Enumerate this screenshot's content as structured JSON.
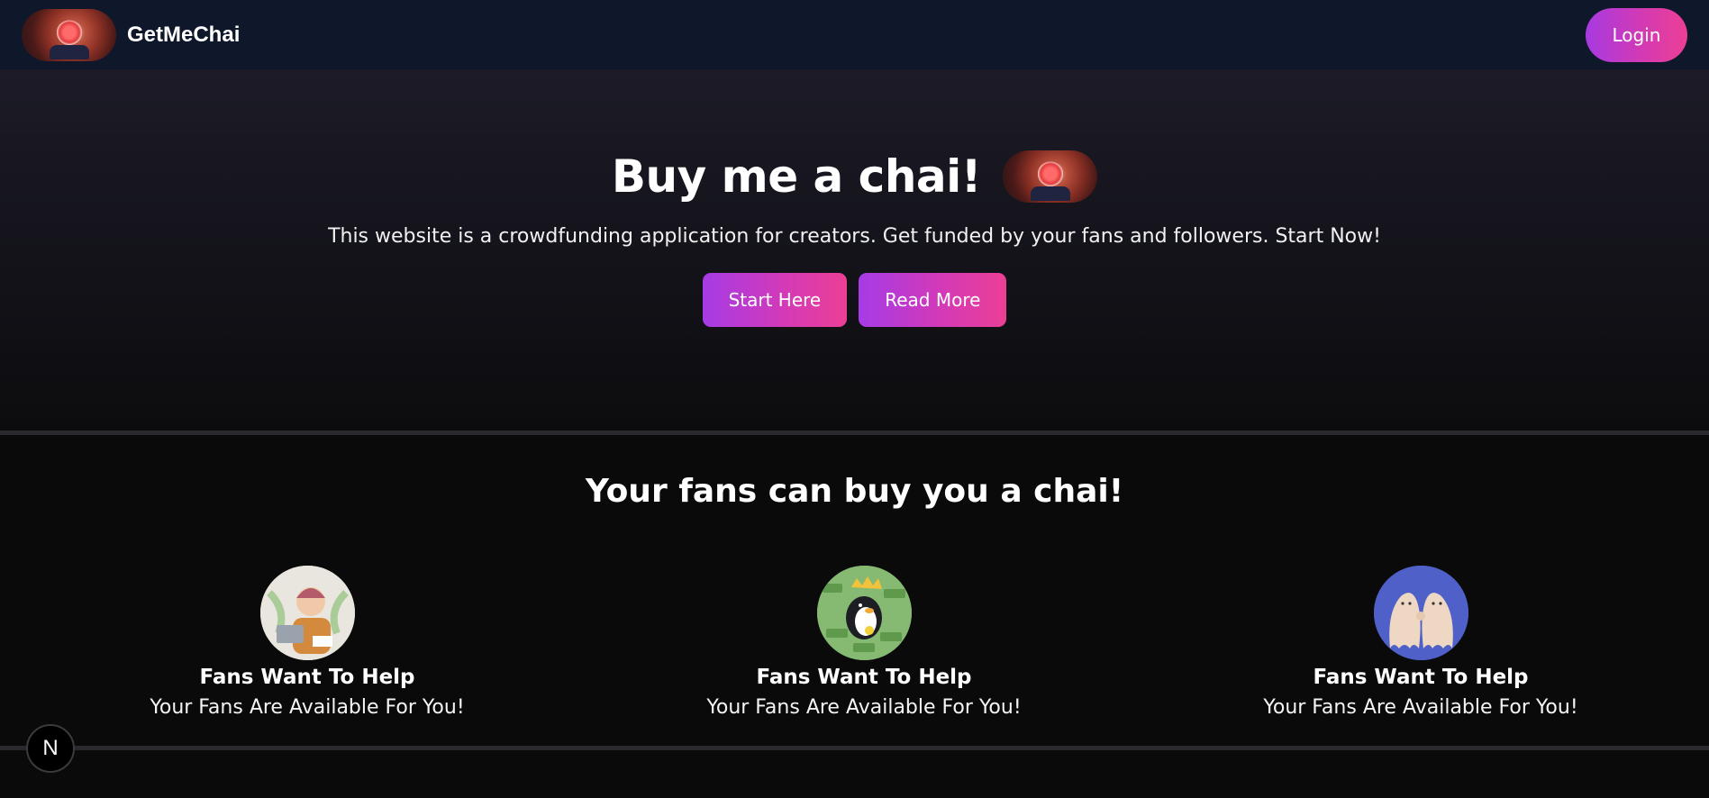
{
  "navbar": {
    "brand_name": "GetMeChai",
    "login_label": "Login",
    "logo_icon": "chai-cup-logo"
  },
  "hero": {
    "title": "Buy me a chai!",
    "subtitle": "This website is a crowdfunding application for creators. Get funded by your fans and followers. Start Now!",
    "start_label": "Start Here",
    "read_more_label": "Read More"
  },
  "features": {
    "title": "Your fans can buy you a chai!",
    "items": [
      {
        "title": "Fans Want To Help",
        "description": "Your Fans Are Available For You!",
        "icon": "person-at-laptop-illustration"
      },
      {
        "title": "Fans Want To Help",
        "description": "Your Fans Are Available For You!",
        "icon": "penguin-with-money-illustration"
      },
      {
        "title": "Fans Want To Help",
        "description": "Your Fans Are Available For You!",
        "icon": "two-ghosts-fist-bump-illustration"
      }
    ]
  },
  "dev_badge": {
    "label": "N"
  },
  "colors": {
    "navbar_bg": "#0f172a",
    "accent_start": "#a73ae0",
    "accent_end": "#ec3f95",
    "page_bg": "#0a0a0b"
  }
}
